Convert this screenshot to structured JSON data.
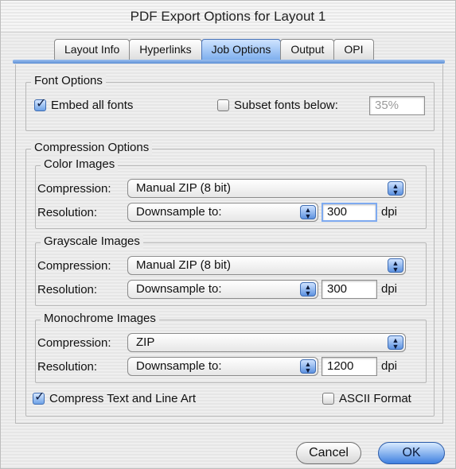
{
  "window": {
    "title": "PDF Export Options for Layout 1"
  },
  "tabs": [
    {
      "label": "Layout Info"
    },
    {
      "label": "Hyperlinks"
    },
    {
      "label": "Job Options"
    },
    {
      "label": "Output"
    },
    {
      "label": "OPI"
    }
  ],
  "active_tab": "Job Options",
  "font_options": {
    "title": "Font Options",
    "embed_all_fonts": {
      "label": "Embed all fonts",
      "checked": true
    },
    "subset_fonts_below": {
      "label": "Subset fonts below:",
      "checked": false,
      "value": "35%"
    }
  },
  "compression_options": {
    "title": "Compression Options",
    "color_images": {
      "title": "Color Images",
      "compression_label": "Compression:",
      "compression_value": "Manual ZIP (8 bit)",
      "resolution_label": "Resolution:",
      "resolution_mode": "Downsample to:",
      "dpi_value": "300",
      "dpi_unit": "dpi"
    },
    "grayscale_images": {
      "title": "Grayscale Images",
      "compression_label": "Compression:",
      "compression_value": "Manual ZIP (8 bit)",
      "resolution_label": "Resolution:",
      "resolution_mode": "Downsample to:",
      "dpi_value": "300",
      "dpi_unit": "dpi"
    },
    "monochrome_images": {
      "title": "Monochrome Images",
      "compression_label": "Compression:",
      "compression_value": "ZIP",
      "resolution_label": "Resolution:",
      "resolution_mode": "Downsample to:",
      "dpi_value": "1200",
      "dpi_unit": "dpi"
    }
  },
  "compress_text": {
    "label": "Compress Text and Line Art",
    "checked": true
  },
  "ascii_format": {
    "label": "ASCII Format",
    "checked": false
  },
  "buttons": {
    "cancel": "Cancel",
    "ok": "OK"
  },
  "icons": {
    "check": "checkmark-icon",
    "popup_arrows": "updown-arrows-icon"
  },
  "colors": {
    "accent": "#5e8fd6",
    "focus": "#7eaaf0"
  }
}
